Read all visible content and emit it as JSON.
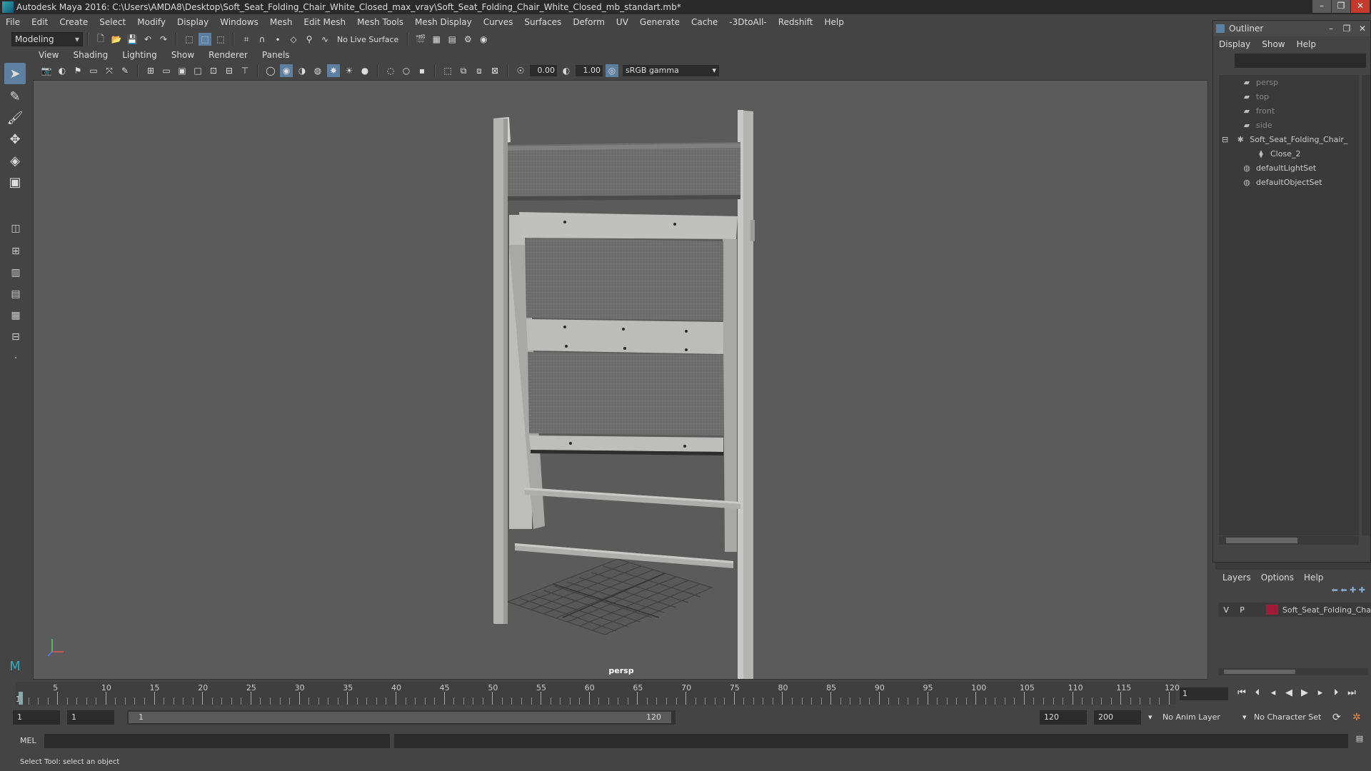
{
  "window": {
    "title": "Autodesk Maya 2016: C:\\Users\\AMDA8\\Desktop\\Soft_Seat_Folding_Chair_White_Closed_max_vray\\Soft_Seat_Folding_Chair_White_Closed_mb_standart.mb*"
  },
  "menubar": [
    "File",
    "Edit",
    "Create",
    "Select",
    "Modify",
    "Display",
    "Windows",
    "Mesh",
    "Edit Mesh",
    "Mesh Tools",
    "Mesh Display",
    "Curves",
    "Surfaces",
    "Deform",
    "UV",
    "Generate",
    "Cache",
    "-3DtoAll-",
    "Redshift",
    "Help"
  ],
  "statusline": {
    "mode": "Modeling",
    "live_surface": "No Live Surface"
  },
  "panel": {
    "menus": [
      "View",
      "Shading",
      "Lighting",
      "Show",
      "Renderer",
      "Panels"
    ],
    "exposure": "0.00",
    "gamma": "1.00",
    "color_space": "sRGB gamma",
    "camera_label": "persp"
  },
  "outliner": {
    "title": "Outliner",
    "menus": [
      "Display",
      "Show",
      "Help"
    ],
    "items": [
      {
        "label": "persp",
        "icon": "camera-icon",
        "dim": true
      },
      {
        "label": "top",
        "icon": "camera-icon",
        "dim": true
      },
      {
        "label": "front",
        "icon": "camera-icon",
        "dim": true
      },
      {
        "label": "side",
        "icon": "camera-icon",
        "dim": true
      },
      {
        "label": "Soft_Seat_Folding_Chair_",
        "icon": "group-icon",
        "dim": false
      },
      {
        "label": "Close_2",
        "icon": "mesh-icon",
        "dim": false
      },
      {
        "label": "defaultLightSet",
        "icon": "set-icon",
        "dim": false
      },
      {
        "label": "defaultObjectSet",
        "icon": "set-icon",
        "dim": false
      }
    ]
  },
  "layers": {
    "menus": [
      "Layers",
      "Options",
      "Help"
    ],
    "row": {
      "v": "V",
      "p": "P",
      "name": "Soft_Seat_Folding_Cha",
      "color": "#a01a3a"
    }
  },
  "timeline": {
    "ticks": [
      5,
      10,
      15,
      20,
      25,
      30,
      35,
      40,
      45,
      50,
      55,
      60,
      65,
      70,
      75,
      80,
      85,
      90,
      95,
      100,
      105,
      110,
      115,
      120
    ],
    "start": 1,
    "end": 120,
    "current_frame": "1",
    "playhead_label": "1"
  },
  "range": {
    "start": "1",
    "playback_start": "1",
    "slider_start": "1",
    "slider_end": "120",
    "playback_end": "120",
    "end": "200",
    "anim_layer": "No Anim Layer",
    "character_set": "No Character Set"
  },
  "cmdline": {
    "label": "MEL"
  },
  "helpline": {
    "text": "Select Tool: select an object"
  },
  "colors": {
    "accent": "#5d7fa0",
    "viewport": "#5b5b5b",
    "chair": "#b0b0ae"
  }
}
